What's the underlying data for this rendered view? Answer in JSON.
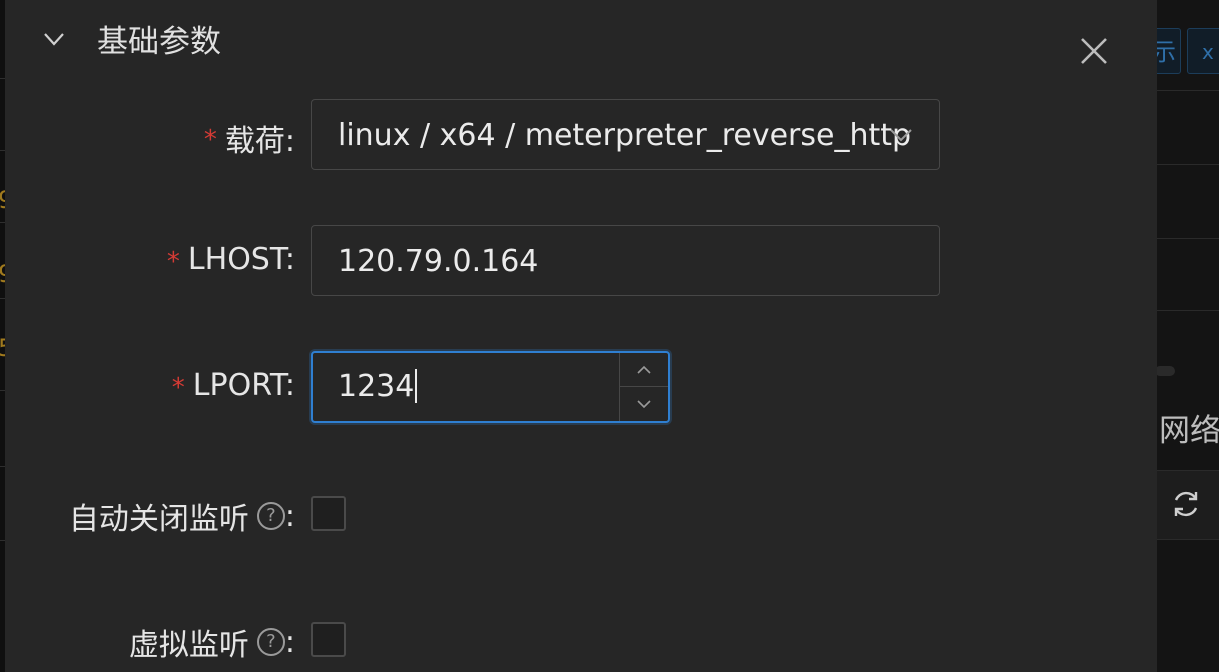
{
  "section": {
    "title": "基础参数"
  },
  "form": {
    "payload": {
      "label": "载荷:",
      "required_mark": "*",
      "value": "linux / x64 / meterpreter_reverse_http"
    },
    "lhost": {
      "label": "LHOST:",
      "required_mark": "*",
      "value": "120.79.0.164"
    },
    "lport": {
      "label": "LPORT:",
      "required_mark": "*",
      "value": "1234"
    },
    "auto_close": {
      "label": "自动关闭监听",
      "colon": ":",
      "help": "?",
      "checked": false
    },
    "virtual": {
      "label": "虚拟监听",
      "colon": ":",
      "help": "?",
      "checked": false
    }
  },
  "background": {
    "right_label": "网络",
    "tag_a": "示",
    "tag_b": "x",
    "left_digits": [
      "9",
      "9",
      "5"
    ]
  },
  "colors": {
    "accent": "#2f7fd1",
    "required": "#d43b35",
    "modal_bg": "#262626"
  },
  "icons": [
    "chevron-down-icon",
    "close-icon",
    "select-arrow-icon",
    "chevron-up-icon",
    "help-icon",
    "refresh-icon"
  ]
}
